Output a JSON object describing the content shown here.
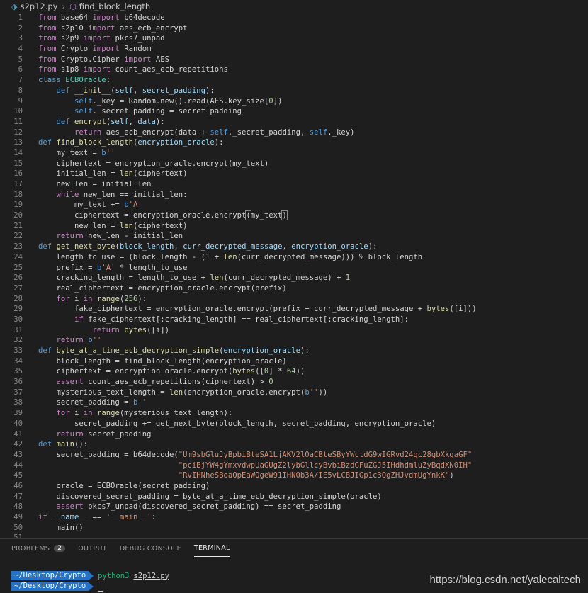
{
  "breadcrumb": {
    "file": "s2p12.py",
    "symbol": "find_block_length"
  },
  "panel": {
    "tabs": [
      "PROBLEMS",
      "OUTPUT",
      "DEBUG CONSOLE",
      "TERMINAL"
    ],
    "problems_count": "2"
  },
  "terminal": {
    "prompt": "~/Desktop/Crypto",
    "command": "python3",
    "argument": "s2p12.py"
  },
  "watermark": "https://blog.csdn.net/yalecaltech",
  "code": [
    "1",
    "2",
    "3",
    "4",
    "5",
    "6",
    "7",
    "8",
    "9",
    "10",
    "11",
    "12",
    "13",
    "14",
    "15",
    "16",
    "17",
    "18",
    "19",
    "20",
    "21",
    "22",
    "23",
    "24",
    "25",
    "26",
    "27",
    "28",
    "29",
    "30",
    "31",
    "32",
    "33",
    "34",
    "35",
    "36",
    "37",
    "38",
    "39",
    "40",
    "41",
    "42",
    "43",
    "44",
    "45",
    "46",
    "47",
    "48",
    "49",
    "50",
    "51"
  ]
}
